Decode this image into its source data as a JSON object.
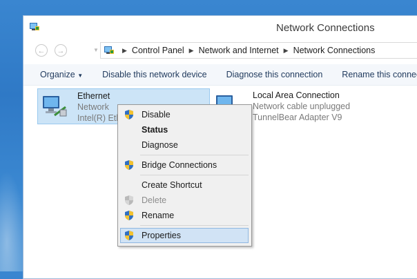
{
  "window": {
    "title": "Network Connections"
  },
  "address": {
    "crumbs": [
      "Control Panel",
      "Network and Internet",
      "Network Connections"
    ]
  },
  "commands": [
    {
      "label": "Organize",
      "has_dropdown": true
    },
    {
      "label": "Disable this network device"
    },
    {
      "label": "Diagnose this connection"
    },
    {
      "label": "Rename this connection"
    }
  ],
  "connections": [
    {
      "name": "Ethernet",
      "status": "Network",
      "adapter": "Intel(R) Eth",
      "selected": true
    },
    {
      "name": "Local Area Connection",
      "status": "Network cable unplugged",
      "adapter": "TunnelBear Adapter V9",
      "selected": false
    }
  ],
  "context_menu": {
    "items": [
      {
        "label": "Disable",
        "shield": true
      },
      {
        "label": "Status",
        "bold": true
      },
      {
        "label": "Diagnose"
      },
      {
        "label": "Bridge Connections",
        "shield": true
      },
      {
        "label": "Create Shortcut"
      },
      {
        "label": "Delete",
        "shield": true,
        "disabled": true
      },
      {
        "label": "Rename",
        "shield": true
      },
      {
        "label": "Properties",
        "shield": true,
        "highlighted": true
      }
    ]
  },
  "colors": {
    "desktop": "#3a86d0",
    "selection": "#cce4f7",
    "menu_highlight": "#d1e3f5"
  }
}
